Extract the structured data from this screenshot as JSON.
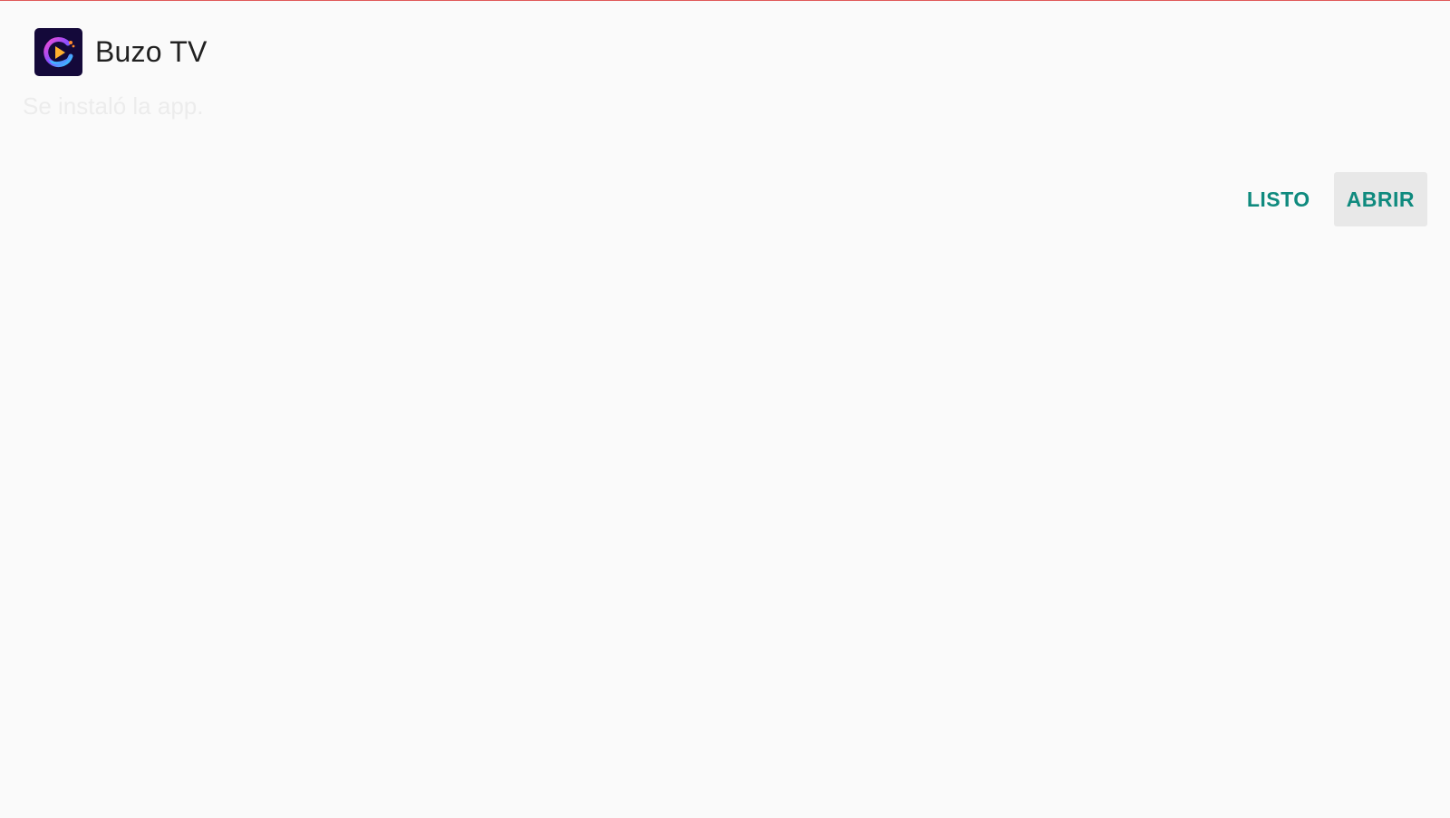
{
  "app": {
    "name": "Buzo TV",
    "icon": "buzo-tv-logo-icon"
  },
  "status": {
    "message": "Se instaló la app."
  },
  "actions": {
    "done_label": "LISTO",
    "open_label": "ABRIR"
  },
  "colors": {
    "accent": "#0f8a7e",
    "background": "#fafafa",
    "focused_button": "#e8e8e8"
  }
}
